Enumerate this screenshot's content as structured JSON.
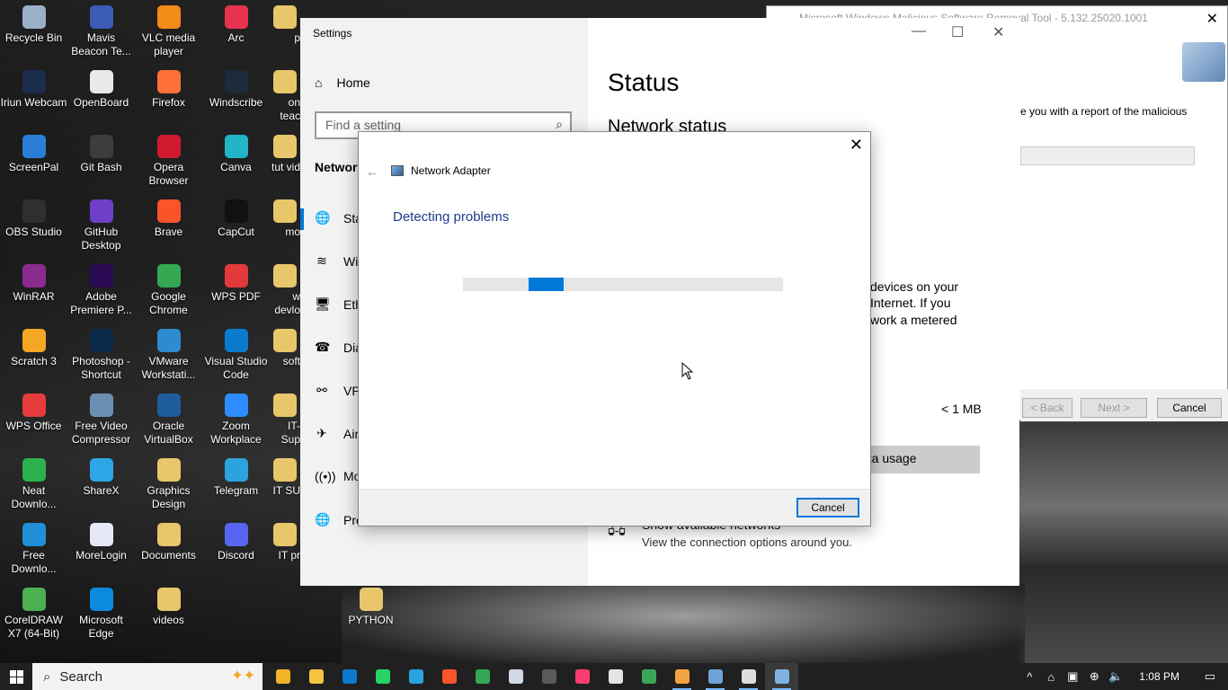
{
  "desktop": {
    "icons": [
      {
        "label": "Recycle Bin",
        "color": "#9ab0c8"
      },
      {
        "label": "Mavis Beacon Te...",
        "color": "#3b5bb5"
      },
      {
        "label": "VLC media player",
        "color": "#f28b18"
      },
      {
        "label": "Arc",
        "color": "#e8334f"
      },
      {
        "label": "Iriun Webcam",
        "color": "#1c2c4c"
      },
      {
        "label": "OpenBoard",
        "color": "#e9e9e9"
      },
      {
        "label": "Firefox",
        "color": "#ff7139"
      },
      {
        "label": "Windscribe",
        "color": "#1d2a3a"
      },
      {
        "label": "ScreenPal",
        "color": "#2a7fd4"
      },
      {
        "label": "Git Bash",
        "color": "#3c3c3c"
      },
      {
        "label": "Opera Browser",
        "color": "#d0192e"
      },
      {
        "label": "Canva",
        "color": "#23b5c7"
      },
      {
        "label": "OBS Studio",
        "color": "#302e31"
      },
      {
        "label": "GitHub Desktop",
        "color": "#6e40c9"
      },
      {
        "label": "Brave",
        "color": "#fb542b"
      },
      {
        "label": "CapCut",
        "color": "#111111"
      },
      {
        "label": "WinRAR",
        "color": "#8a2b8e"
      },
      {
        "label": "Adobe Premiere P...",
        "color": "#2a0a52"
      },
      {
        "label": "Google Chrome",
        "color": "#34a853"
      },
      {
        "label": "WPS PDF",
        "color": "#e23a3a"
      },
      {
        "label": "Scratch 3",
        "color": "#f5a623"
      },
      {
        "label": "Photoshop - Shortcut",
        "color": "#0b2a4a"
      },
      {
        "label": "VMware Workstati...",
        "color": "#2e8bd0"
      },
      {
        "label": "Visual Studio Code",
        "color": "#0a7acc"
      },
      {
        "label": "WPS Office",
        "color": "#e63b3b"
      },
      {
        "label": "Free Video Compressor",
        "color": "#6b8fb3"
      },
      {
        "label": "Oracle VirtualBox",
        "color": "#1e5c9e"
      },
      {
        "label": "Zoom Workplace",
        "color": "#2d8cff"
      },
      {
        "label": "Neat Downlo...",
        "color": "#2bb24c"
      },
      {
        "label": "ShareX",
        "color": "#2ea6e6"
      },
      {
        "label": "Graphics Design",
        "color": "#e8c66a"
      },
      {
        "label": "Telegram",
        "color": "#2aa3de"
      },
      {
        "label": "Free Downlo...",
        "color": "#1f8fd8"
      },
      {
        "label": "MoreLogin",
        "color": "#e5e9f5"
      },
      {
        "label": "Documents",
        "color": "#e8c66a"
      },
      {
        "label": "Discord",
        "color": "#5865f2"
      },
      {
        "label": "CorelDRAW X7 (64-Bit)",
        "color": "#4caf50"
      },
      {
        "label": "Microsoft Edge",
        "color": "#0c8adf"
      },
      {
        "label": "videos",
        "color": "#e8c66a"
      }
    ],
    "partial_icons": [
      {
        "label": "p"
      },
      {
        "label": "on teac"
      },
      {
        "label": "tut vid"
      },
      {
        "label": "mo"
      },
      {
        "label": "w devlo"
      },
      {
        "label": "soft"
      },
      {
        "label": "IT-Sup"
      },
      {
        "label": "IT SU"
      },
      {
        "label": "IT pr"
      },
      {
        "label": "PYTHON"
      }
    ]
  },
  "msrt": {
    "title": "Microsoft Windows Malicious Software Removal Tool - 5.132.25020.1001",
    "text": "e you with a report of the malicious",
    "back_label": "< Back",
    "next_label": "Next >",
    "cancel_label": "Cancel"
  },
  "settings": {
    "title": "Settings",
    "home_label": "Home",
    "search_placeholder": "Find a setting",
    "section_label": "Networ",
    "nav_items": [
      {
        "label": "Sta",
        "icon": "globe-icon",
        "glyph": "🌐"
      },
      {
        "label": "Wi",
        "icon": "wifi-icon",
        "glyph": "≋"
      },
      {
        "label": "Eth",
        "icon": "ethernet-icon",
        "glyph": "🖥"
      },
      {
        "label": "Dia",
        "icon": "dialup-icon",
        "glyph": "☎"
      },
      {
        "label": "VP",
        "icon": "vpn-icon",
        "glyph": "⚯"
      },
      {
        "label": "Air",
        "icon": "airplane-icon",
        "glyph": "✈"
      },
      {
        "label": "Mo",
        "icon": "hotspot-icon",
        "glyph": "((•))"
      },
      {
        "label": "Pro",
        "icon": "proxy-icon",
        "glyph": "🌐"
      }
    ],
    "page_title": "Status",
    "network_status_label": "Network status",
    "para_lines": [
      "devices on your",
      "Internet. If you",
      "work a metered"
    ],
    "data_value": "< 1 MB",
    "data_usage_label": "ata usage",
    "available_title": "Show available networks",
    "available_sub": "View the connection options around you."
  },
  "dialog": {
    "app_name": "Network Adapter",
    "heading": "Detecting problems",
    "progress_fraction": 0.11,
    "progress_offset_fraction": 0.205,
    "cancel_label": "Cancel"
  },
  "taskbar": {
    "search_label": "Search",
    "apps": [
      {
        "name": "copilot-app",
        "color": "#f0b429"
      },
      {
        "name": "file-explorer-app",
        "color": "#f4c542"
      },
      {
        "name": "vscode-app",
        "color": "#0a7acc"
      },
      {
        "name": "whatsapp-app",
        "color": "#25d366"
      },
      {
        "name": "telegram-app",
        "color": "#2aa3de"
      },
      {
        "name": "brave-app",
        "color": "#fb542b"
      },
      {
        "name": "chrome-app",
        "color": "#34a853"
      },
      {
        "name": "wordpress-app",
        "color": "#cfd8e3"
      },
      {
        "name": "obs-app",
        "color": "#5a5a5a"
      },
      {
        "name": "opera-gx-app",
        "color": "#ff3c6f"
      },
      {
        "name": "iriun-app",
        "color": "#e5e5e5"
      },
      {
        "name": "wps-app",
        "color": "#3aa757"
      },
      {
        "name": "vmware-app",
        "color": "#f2a341"
      },
      {
        "name": "malicious-removal-app",
        "color": "#6fa2d6"
      },
      {
        "name": "settings-app",
        "color": "#dddddd"
      },
      {
        "name": "network-troubleshooter-app",
        "color": "#7fb2e0"
      }
    ],
    "time": "1:08 PM"
  }
}
